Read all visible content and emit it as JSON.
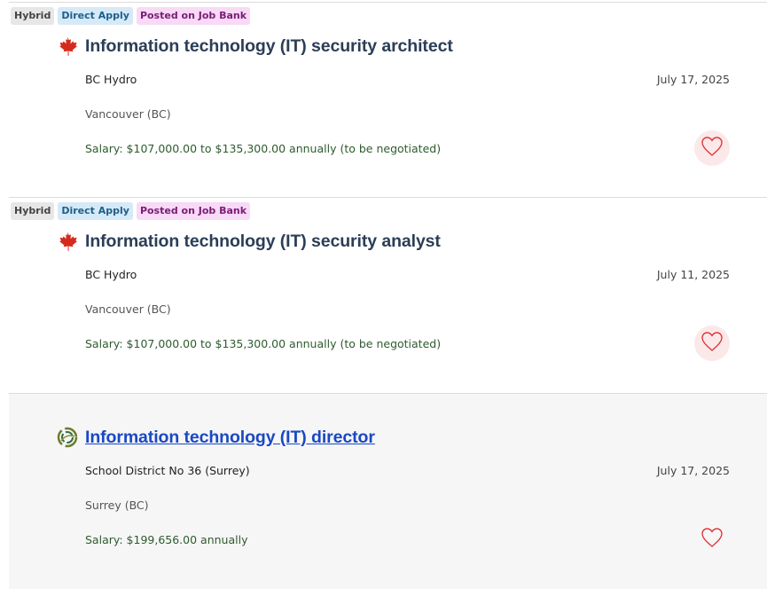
{
  "jobs": [
    {
      "badges": [
        "Hybrid",
        "Direct Apply",
        "Posted on Job Bank"
      ],
      "logo": "maple-leaf-icon",
      "title": "Information technology (IT) security architect",
      "employer": "BC Hydro",
      "location": "Vancouver (BC)",
      "salary": "Salary: $107,000.00 to $135,300.00 annually (to be negotiated)",
      "date": "July 17, 2025",
      "favorite_icon": "heart-icon"
    },
    {
      "badges": [
        "Hybrid",
        "Direct Apply",
        "Posted on Job Bank"
      ],
      "logo": "maple-leaf-icon",
      "title": "Information technology (IT) security analyst",
      "employer": "BC Hydro",
      "location": "Vancouver (BC)",
      "salary": "Salary: $107,000.00 to $135,300.00 annually (to be negotiated)",
      "date": "July 11, 2025",
      "favorite_icon": "heart-icon"
    },
    {
      "badges": [],
      "logo": "school-district-logo",
      "title": "Information technology (IT) director",
      "employer": "School District No 36 (Surrey)",
      "location": "Surrey (BC)",
      "salary": "Salary: $199,656.00 annually",
      "date": "July 17, 2025",
      "favorite_icon": "heart-icon"
    }
  ],
  "colors": {
    "title": "#2b3e57",
    "title_link": "#1a48c4",
    "salary": "#2e5b2e",
    "heart": "#e0393e",
    "maple_leaf": "#d52b1e"
  }
}
